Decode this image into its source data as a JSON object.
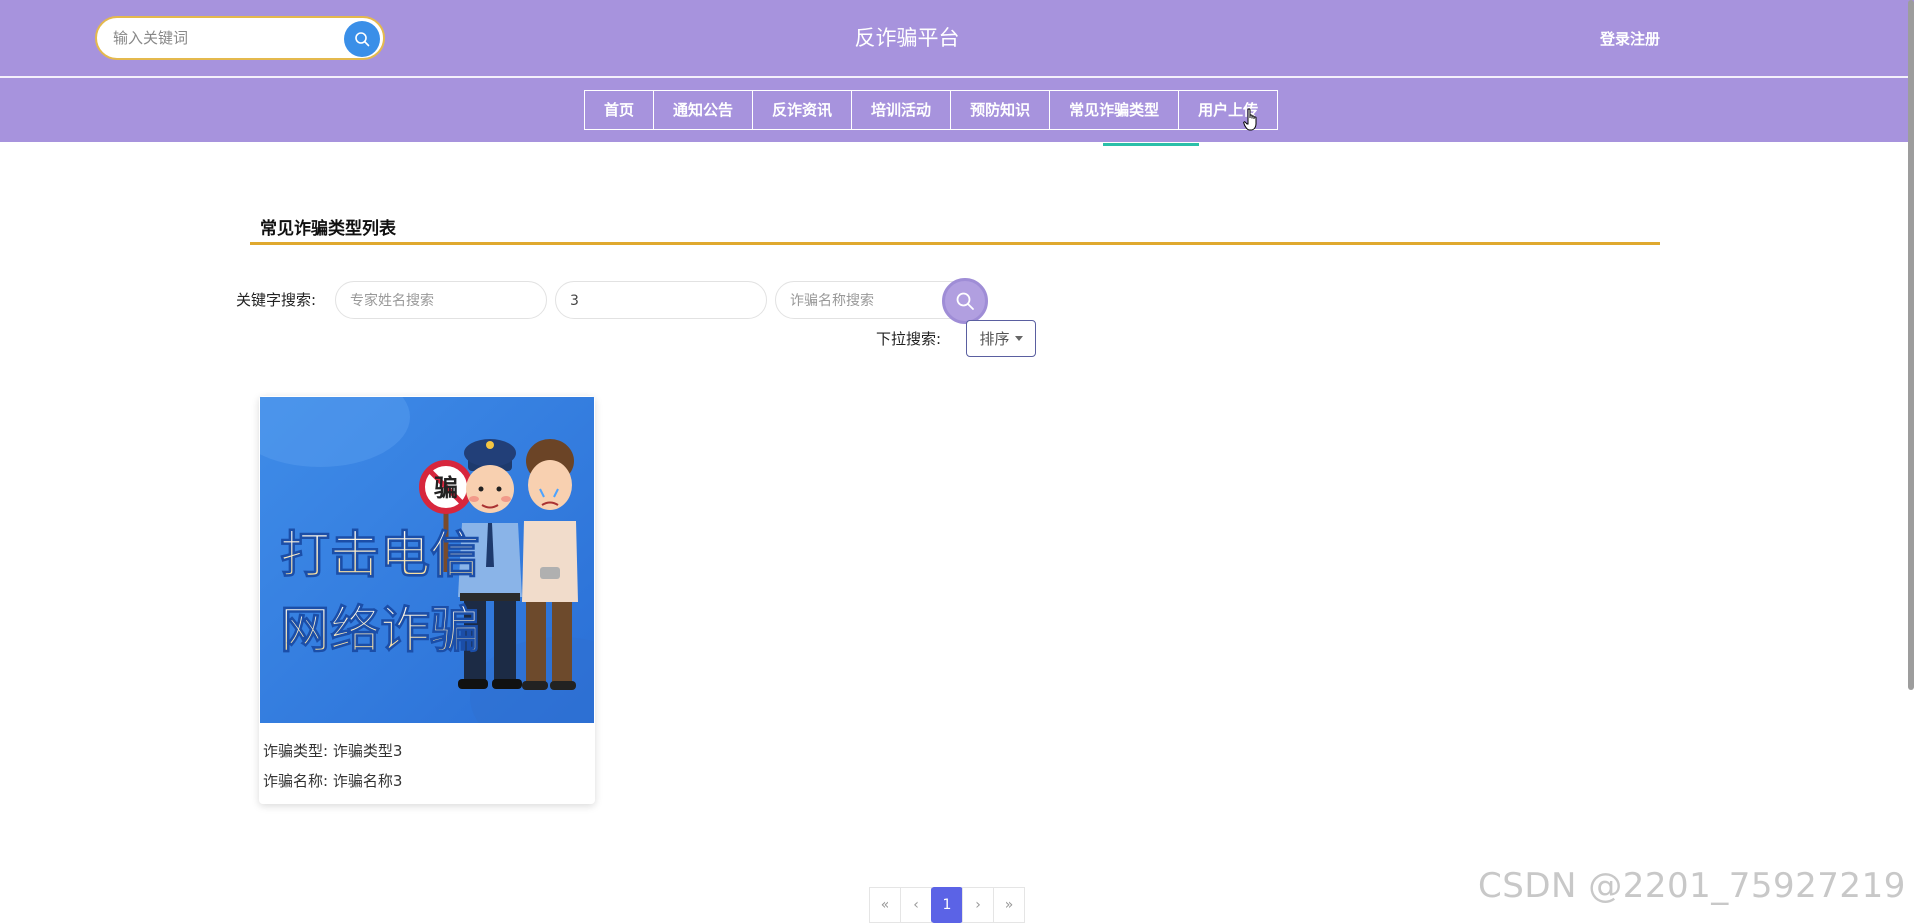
{
  "header": {
    "search_placeholder": "输入关键词",
    "site_title": "反诈骗平台",
    "login_label": "登录注册"
  },
  "nav": {
    "items": [
      "首页",
      "通知公告",
      "反诈资讯",
      "培训活动",
      "预防知识",
      "常见诈骗类型",
      "用户上传"
    ],
    "active_index": 5
  },
  "section": {
    "title": "常见诈骗类型列表"
  },
  "filters": {
    "keyword_label": "关键字搜索:",
    "field1_placeholder": "专家姓名搜索",
    "field2_value": "3",
    "field3_placeholder": "诈骗名称搜索",
    "dropdown_label": "下拉搜索:",
    "sort_label": "排序"
  },
  "card": {
    "image_text_line1": "打击电信",
    "image_text_line2": "网络诈骗",
    "sign_text": "骗",
    "type_line": "诈骗类型: 诈骗类型3",
    "name_line": "诈骗名称: 诈骗名称3"
  },
  "pagination": {
    "first": "«",
    "prev": "‹",
    "current": "1",
    "next": "›",
    "last": "»"
  },
  "watermark": "CSDN @2201_75927219",
  "colors": {
    "header_bg": "#a793dd",
    "active_underline": "#2bbfa8",
    "section_line": "#e0a92f",
    "pagination_active": "#5b63e6"
  }
}
